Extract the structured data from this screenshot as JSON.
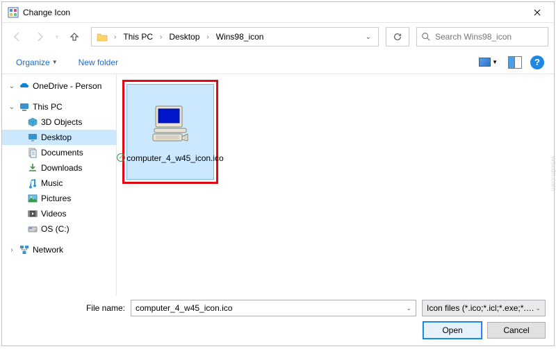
{
  "window": {
    "title": "Change Icon"
  },
  "breadcrumb": {
    "items": [
      "This PC",
      "Desktop",
      "Wins98_icon"
    ]
  },
  "search": {
    "placeholder": "Search Wins98_icon"
  },
  "toolbar": {
    "organize": "Organize",
    "new_folder": "New folder"
  },
  "sidebar": {
    "onedrive": "OneDrive - Person",
    "thispc": "This PC",
    "items": [
      "3D Objects",
      "Desktop",
      "Documents",
      "Downloads",
      "Music",
      "Pictures",
      "Videos",
      "OS (C:)"
    ],
    "selected_index": 1,
    "network": "Network"
  },
  "file": {
    "name": "computer_4_w45_icon.ico"
  },
  "footer": {
    "filename_label": "File name:",
    "filename_value": "computer_4_w45_icon.ico",
    "filter": "Icon files (*.ico;*.icl;*.exe;*.dll)",
    "open": "Open",
    "cancel": "Cancel"
  },
  "watermark": "wsxdn.com"
}
